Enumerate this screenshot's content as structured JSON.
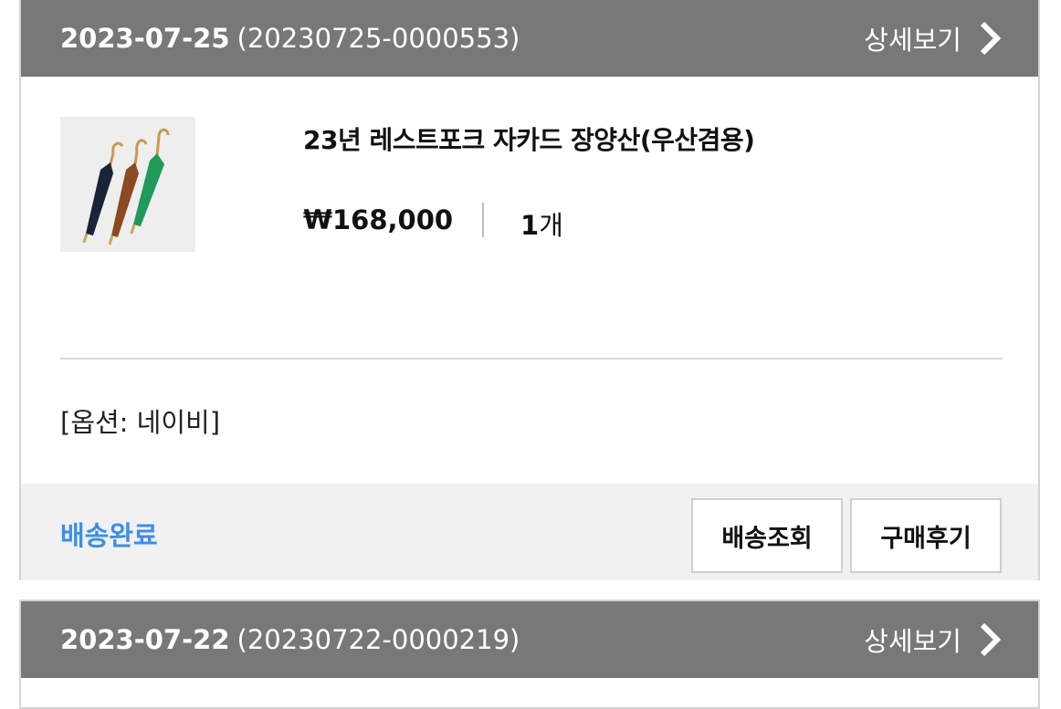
{
  "orders": [
    {
      "date": "2023-07-25",
      "order_number": "(20230725-0000553)",
      "detail_label": "상세보기",
      "item": {
        "name": "23년 레스트포크 자카드 장양산(우산겸용)",
        "price": "₩168,000",
        "quantity_number": "1",
        "quantity_unit": "개",
        "option": "[옵션: 네이비]"
      },
      "status": "배송완료",
      "status_color": "#3c8ee8",
      "buttons": {
        "track": "배송조회",
        "review": "구매후기"
      }
    },
    {
      "date": "2023-07-22",
      "order_number": "(20230722-0000219)",
      "detail_label": "상세보기"
    }
  ],
  "icons": {
    "detail": "chevron-right-icon",
    "thumbnail": "umbrella-product-image"
  }
}
